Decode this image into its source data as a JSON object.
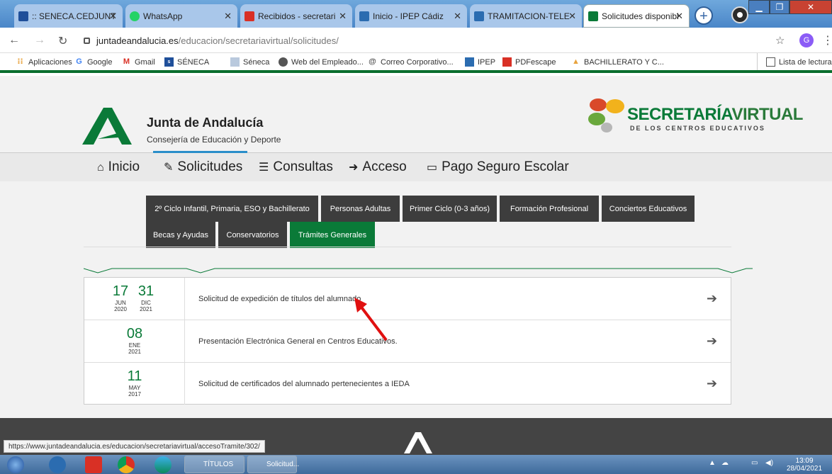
{
  "browser": {
    "tabs": [
      {
        "label": ":: SENECA.CEDJUNT",
        "color": "#1f4f9a"
      },
      {
        "label": "WhatsApp",
        "color": "#25d366"
      },
      {
        "label": "Recibidos - secretari",
        "color": "#d93025"
      },
      {
        "label": "Inicio - IPEP Cádiz",
        "color": "#2b6cb0"
      },
      {
        "label": "TRAMITACION-TELE",
        "color": "#2b6cb0"
      },
      {
        "label": "Solicitudes disponibl",
        "color": "#0a7a38"
      }
    ],
    "url_domain": "juntadeandalucia.es",
    "url_path": "/educacion/secretariavirtual/solicitudes/",
    "profile_letter": "G",
    "bookmarks": [
      "Aplicaciones",
      "Google",
      "Gmail",
      "SÉNECA",
      "Séneca",
      "Web del Empleado...",
      "Correo Corporativo...",
      "IPEP",
      "PDFescape",
      "BACHILLERATO Y C..."
    ],
    "bookmark_icons": [
      "grid-icon",
      "google-icon",
      "gmail-icon",
      "seneca-icon",
      "seneca-doc-icon",
      "globe-icon",
      "mail-at-icon",
      "ipep-icon",
      "pdf-icon",
      "bachillerato-icon"
    ],
    "reading_list": "Lista de lectura"
  },
  "site": {
    "org_name": "Junta de Andalucía",
    "org_sub": "Consejería de Educación y Deporte",
    "brand_title_a": "SECRETARÍA",
    "brand_title_b": "VIRTUAL",
    "brand_sub": "DE LOS CENTROS EDUCATIVOS",
    "accent": "#0a7a38",
    "menu": [
      "Inicio",
      "Solicitudes",
      "Consultas",
      "Acceso",
      "Pago Seguro Escolar"
    ],
    "categories_row1": [
      "2º Ciclo Infantil, Primaria, ESO y Bachillerato",
      "Personas Adultas",
      "Primer Ciclo (0-3 años)",
      "Formación Profesional",
      "Conciertos Educativos"
    ],
    "categories_row2": [
      "Becas y Ayudas",
      "Conservatorios",
      "Trámites Generales"
    ],
    "active_category": "Trámites Generales",
    "procedures": [
      {
        "d1": "17",
        "d2": "31",
        "m1": "JUN",
        "m2": "DIC",
        "y1": "2020",
        "y2": "2021",
        "title": "Solicitud de expedición de títulos del alumnado"
      },
      {
        "d1": "08",
        "d2": "",
        "m1": "ENE",
        "m2": "",
        "y1": "2021",
        "y2": "",
        "title": "Presentación Electrónica General en Centros Educativos."
      },
      {
        "d1": "11",
        "d2": "",
        "m1": "MAY",
        "m2": "",
        "y1": "2017",
        "y2": "",
        "title": "Solicitud de certificados del alumnado pertenecientes a IEDA"
      }
    ]
  },
  "status_url": "https://www.juntadeandalucia.es/educacion/secretariavirtual/accesoTramite/302/",
  "taskbar": {
    "windows": [
      "TÍTULOS",
      "Solicitud..."
    ],
    "time": "13:09",
    "date": "28/04/2021"
  }
}
